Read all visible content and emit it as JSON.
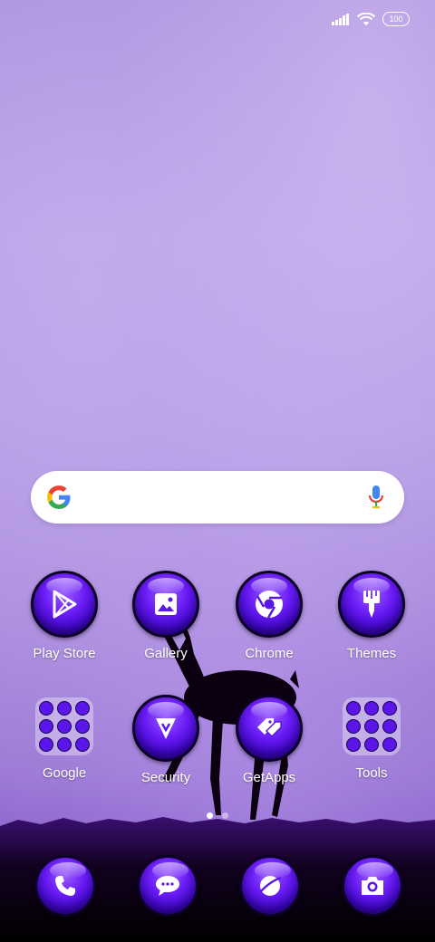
{
  "status_bar": {
    "battery_level": "100",
    "icons": [
      "signal-icon",
      "wifi-icon",
      "battery-icon"
    ]
  },
  "search": {
    "logo": "google-g-icon",
    "mic": "mic-icon"
  },
  "row1": [
    {
      "label": "Play Store",
      "icon": "play-store-icon"
    },
    {
      "label": "Gallery",
      "icon": "gallery-icon"
    },
    {
      "label": "Chrome",
      "icon": "chrome-icon"
    },
    {
      "label": "Themes",
      "icon": "themes-brush-icon"
    }
  ],
  "row2": [
    {
      "label": "Google",
      "type": "folder"
    },
    {
      "label": "Security",
      "icon": "security-icon"
    },
    {
      "label": "GetApps",
      "icon": "getapps-icon"
    },
    {
      "label": "Tools",
      "type": "folder"
    }
  ],
  "page_indicator": {
    "pages": 2,
    "current": 1
  },
  "dock": [
    {
      "icon": "phone-icon"
    },
    {
      "icon": "messages-icon"
    },
    {
      "icon": "browser-icon"
    },
    {
      "icon": "camera-icon"
    }
  ],
  "colors": {
    "accent": "#6a1cf5",
    "wallpaper": "#b39be4"
  }
}
